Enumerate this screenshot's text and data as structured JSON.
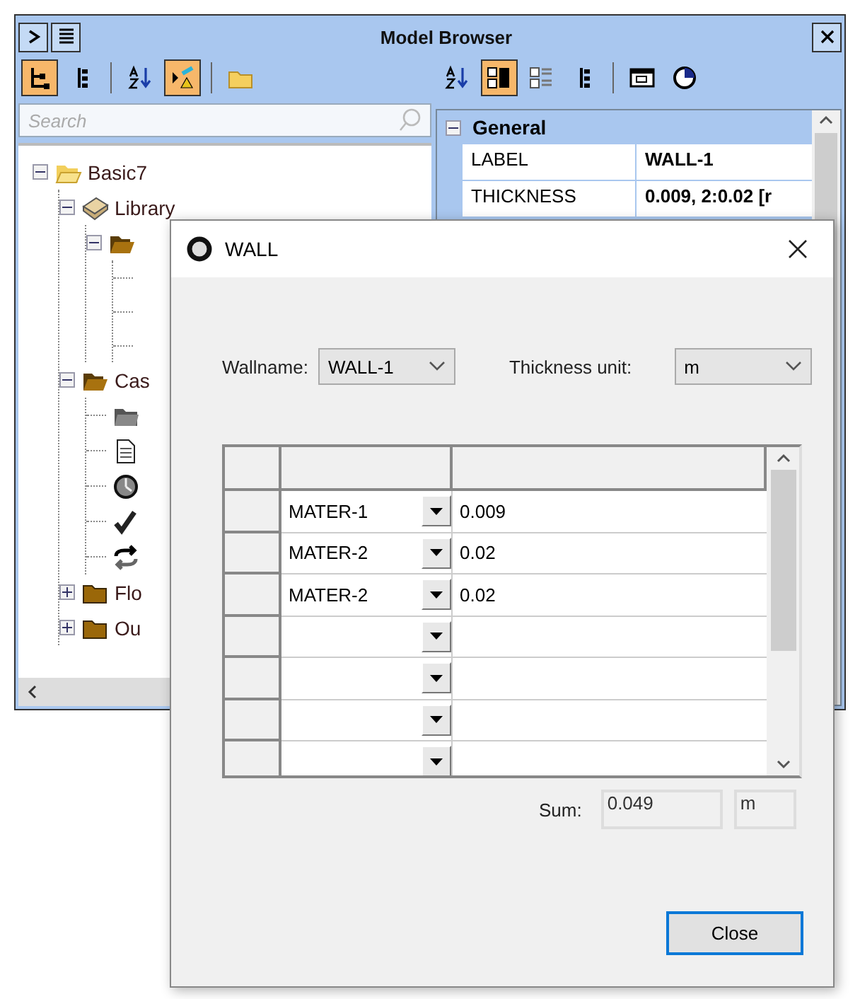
{
  "browser": {
    "title": "Model Browser",
    "left_toolbar": [
      {
        "kind": "tree",
        "selected": true
      },
      {
        "kind": "list",
        "selected": false
      },
      {
        "kind": "sort",
        "selected": false
      },
      {
        "kind": "filter",
        "selected": true
      },
      {
        "kind": "folder",
        "selected": false
      }
    ],
    "search": {
      "placeholder": "Search"
    },
    "tree": [
      {
        "label": "Basic7",
        "kind": "open-folder",
        "expanded": true,
        "children": [
          {
            "label": "Library",
            "kind": "book",
            "expanded": true,
            "children": [
              {
                "kind": "brown-folder",
                "expanded": true,
                "children": [
                  {
                    "kind": "blank"
                  },
                  {
                    "kind": "blank"
                  },
                  {
                    "kind": "blank"
                  }
                ]
              }
            ]
          },
          {
            "label": "Cas",
            "kind": "brown-folder",
            "expanded": true,
            "children": [
              {
                "kind": "grey-folder"
              },
              {
                "kind": "document"
              },
              {
                "kind": "clock"
              },
              {
                "kind": "check"
              },
              {
                "kind": "sync"
              }
            ]
          },
          {
            "label": "Flo",
            "kind": "closed-folder",
            "expanded": false
          },
          {
            "label": "Ou",
            "kind": "closed-folder",
            "expanded": false
          }
        ]
      }
    ],
    "right_toolbar": [
      {
        "kind": "sort",
        "selected": false
      },
      {
        "kind": "categories",
        "selected": true
      },
      {
        "kind": "expand",
        "selected": false
      },
      {
        "kind": "list",
        "selected": false
      },
      {
        "kind": "window",
        "selected": false
      },
      {
        "kind": "pie",
        "selected": false
      }
    ],
    "section": {
      "title": "General",
      "expanded": true
    },
    "properties": [
      {
        "name": "LABEL",
        "value": "WALL-1"
      },
      {
        "name": "THICKNESS",
        "value": "0.009, 2:0.02 [r"
      }
    ]
  },
  "dialog": {
    "title": "WALL",
    "wallname_label": "Wallname:",
    "wallname": "WALL-1",
    "unit_label": "Thickness unit:",
    "unit": "m",
    "rows": [
      {
        "material": "MATER-1",
        "thickness": "0.009"
      },
      {
        "material": "MATER-2",
        "thickness": "0.02"
      },
      {
        "material": "MATER-2",
        "thickness": "0.02"
      },
      {},
      {},
      {},
      {}
    ],
    "sum_label": "Sum:",
    "sum": "0.049",
    "sum_unit": "m",
    "close_button": "Close"
  }
}
